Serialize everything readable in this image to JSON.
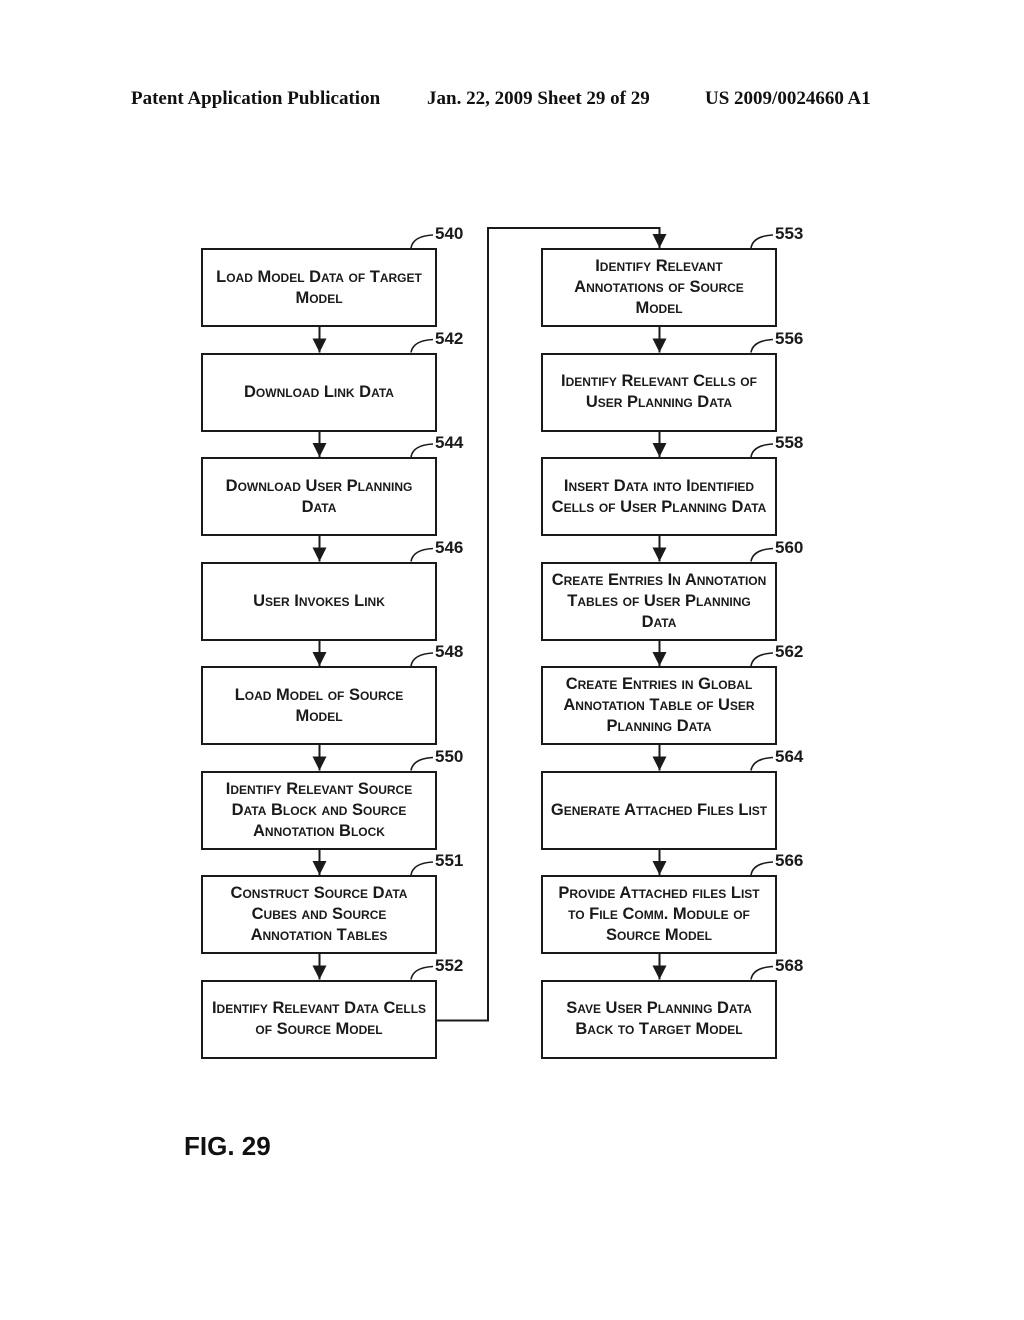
{
  "header": {
    "publication": "Patent Application Publication",
    "date_sheet": "Jan. 22, 2009  Sheet 29 of 29",
    "patent_number": "US 2009/0024660 A1"
  },
  "figure_label": "FIG. 29",
  "flowchart": {
    "left_column": [
      {
        "ref": "540",
        "text": "Load Model Data of Target Model"
      },
      {
        "ref": "542",
        "text": "Download Link Data"
      },
      {
        "ref": "544",
        "text": "Download User Planning Data"
      },
      {
        "ref": "546",
        "text": "User Invokes Link"
      },
      {
        "ref": "548",
        "text": "Load Model of Source Model"
      },
      {
        "ref": "550",
        "text": "Identify Relevant Source Data Block and Source Annotation Block"
      },
      {
        "ref": "551",
        "text": "Construct Source Data Cubes and Source Annotation Tables"
      },
      {
        "ref": "552",
        "text": "Identify Relevant Data Cells of Source Model"
      }
    ],
    "right_column": [
      {
        "ref": "553",
        "text": "Identify Relevant Annotations of Source Model"
      },
      {
        "ref": "556",
        "text": "Identify Relevant Cells of User Planning Data"
      },
      {
        "ref": "558",
        "text": "Insert Data into Identified Cells of User Planning Data"
      },
      {
        "ref": "560",
        "text": "Create Entries In Annotation Tables of User Planning Data"
      },
      {
        "ref": "562",
        "text": "Create Entries in Global Annotation Table of User Planning Data"
      },
      {
        "ref": "564",
        "text": "Generate Attached Files List"
      },
      {
        "ref": "566",
        "text": "Provide Attached files List to File Comm. Module of Source Model"
      },
      {
        "ref": "568",
        "text": "Save User Planning Data Back to Target Model"
      }
    ]
  }
}
